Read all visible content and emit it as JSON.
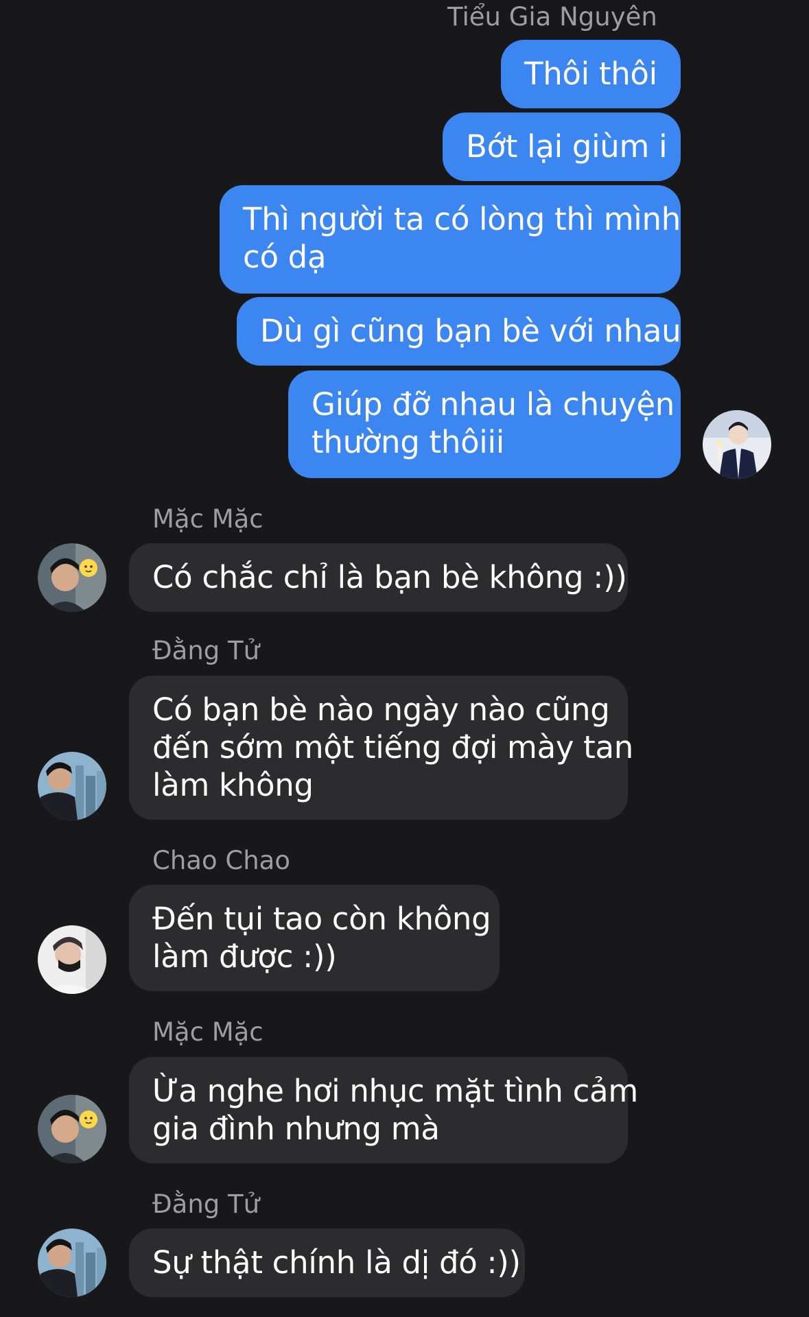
{
  "header": {
    "top_sender": "Tiểu Gia Nguyên"
  },
  "outgoing": [
    {
      "lines": [
        "Thôi thôi"
      ]
    },
    {
      "lines": [
        "Bớt lại giùm i"
      ]
    },
    {
      "lines": [
        "Thì người ta có lòng thì mình",
        "có dạ"
      ]
    },
    {
      "lines": [
        "Dù gì cũng bạn bè với nhau"
      ]
    },
    {
      "lines": [
        "Giúp đỡ nhau là chuyện",
        "thường thôiii"
      ]
    }
  ],
  "incoming": [
    {
      "sender": "Mặc Mặc",
      "lines": [
        "Có chắc chỉ là bạn bè không :))"
      ]
    },
    {
      "sender": "Đằng Tử",
      "lines": [
        "Có bạn bè nào ngày nào cũng",
        "đến sớm một tiếng đợi mày tan",
        "làm không"
      ]
    },
    {
      "sender": "Chao Chao",
      "lines": [
        "Đến tụi tao còn không",
        "làm được :))"
      ]
    },
    {
      "sender": "Mặc Mặc",
      "lines": [
        "Ừa nghe hơi nhục mặt tình cảm",
        "gia đình nhưng mà"
      ]
    },
    {
      "sender": "Đằng Tử",
      "lines": [
        "Sự thật chính là dị đó :))"
      ]
    }
  ],
  "colors": {
    "background": "#18181a",
    "outgoing_bubble": "#3c86f2",
    "incoming_bubble": "#2c2c2f",
    "sender_name": "#9d9da3"
  },
  "icons": {
    "my_avatar": "avatar-performer-icon",
    "mac_mac_avatar": "avatar-boy-sticker-icon",
    "dang_tu_avatar": "avatar-boy-city-icon",
    "chao_chao_avatar": "avatar-boy-mask-icon"
  }
}
